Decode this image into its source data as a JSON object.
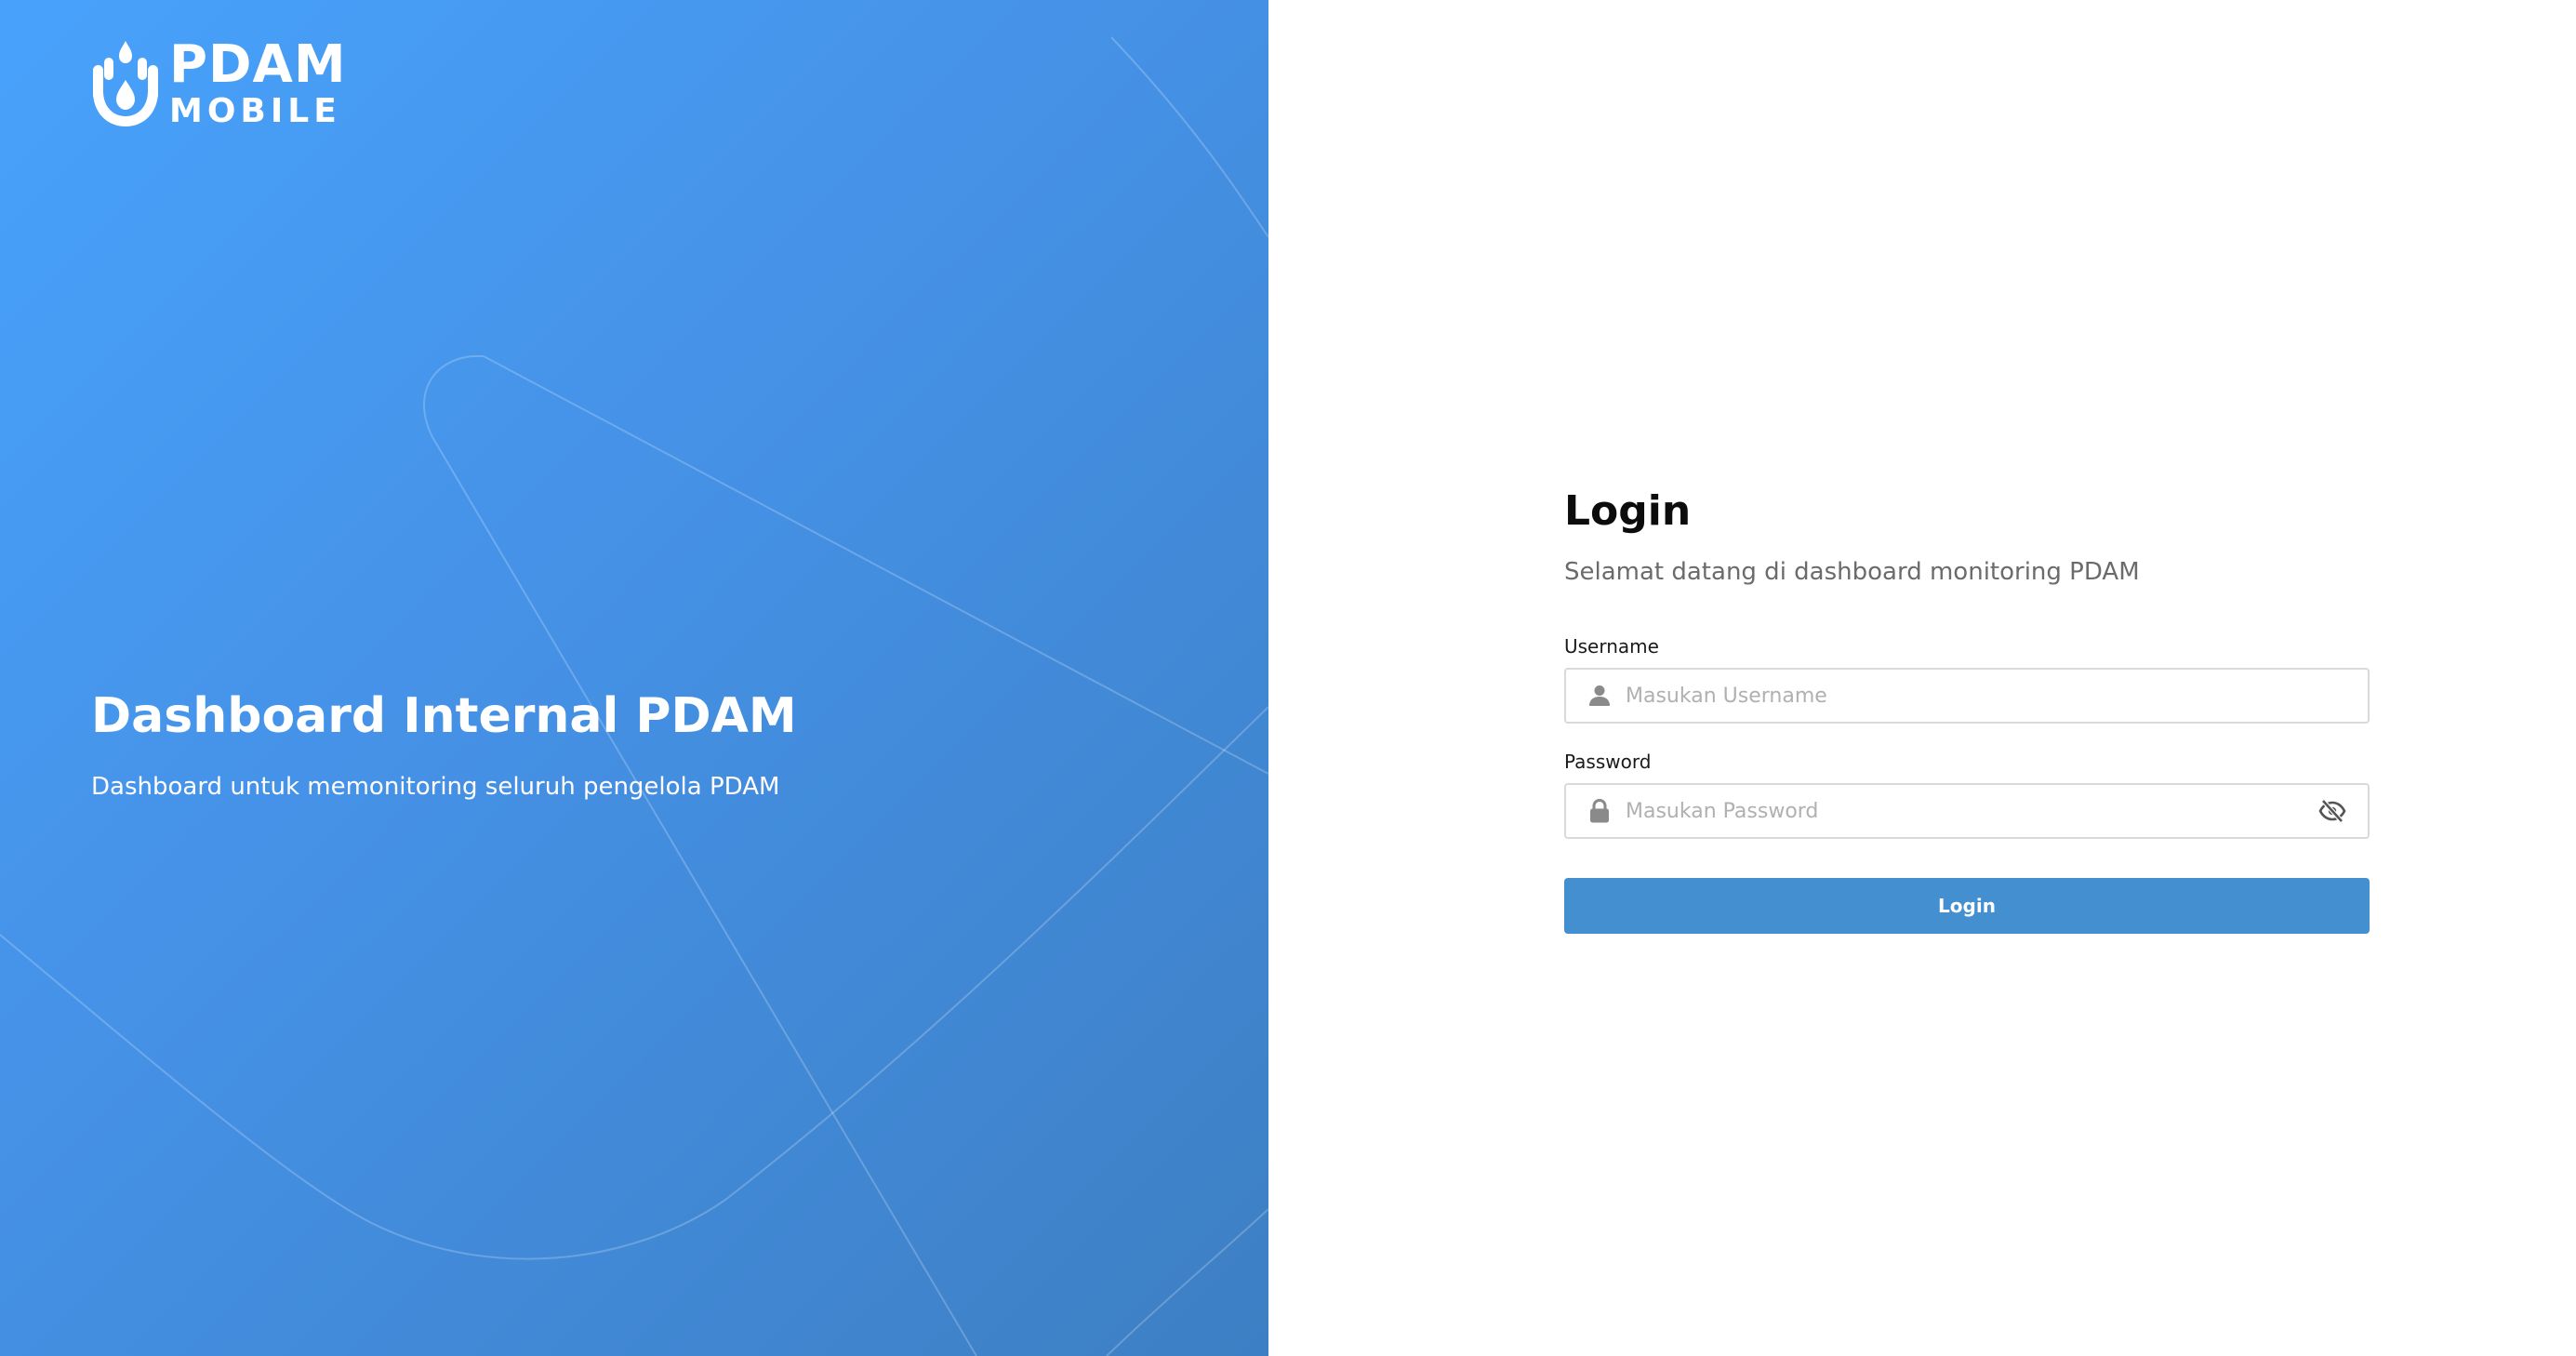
{
  "brand": {
    "line1": "PDAM",
    "line2": "MOBILE",
    "logo_icon": "water-drop-hand-icon"
  },
  "hero": {
    "title": "Dashboard Internal PDAM",
    "subtitle": "Dashboard untuk memonitoring seluruh pengelola PDAM"
  },
  "login": {
    "title": "Login",
    "subtitle": "Selamat datang di dashboard monitoring PDAM",
    "username": {
      "label": "Username",
      "placeholder": "Masukan Username",
      "value": "",
      "icon": "user-icon"
    },
    "password": {
      "label": "Password",
      "placeholder": "Masukan Password",
      "value": "",
      "icon": "lock-icon",
      "toggle_icon": "eye-slash-icon"
    },
    "button_label": "Login"
  },
  "colors": {
    "hero_gradient_start": "#48a2fb",
    "hero_gradient_end": "#3d7fc3",
    "button": "#438fcf",
    "title_text": "#0c0c0c",
    "subtitle_text": "#6b6b6b"
  }
}
